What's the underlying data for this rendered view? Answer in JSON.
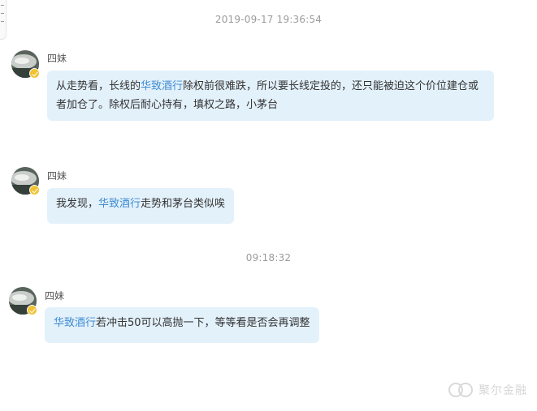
{
  "timestamps": [
    "2019-09-17 19:36:54",
    "09:18:32"
  ],
  "messages": [
    {
      "sender": "四妹",
      "segments": [
        {
          "text": "从走势看，长线的",
          "stock": false
        },
        {
          "text": "华致酒行",
          "stock": true
        },
        {
          "text": "除权前很难跌，所以要长线定投的，还只能被迫这个价位建仓或者加仓了。除权后耐心持有，填权之路，小茅台",
          "stock": false
        }
      ]
    },
    {
      "sender": "四妹",
      "segments": [
        {
          "text": "我发现，",
          "stock": false
        },
        {
          "text": "华致酒行",
          "stock": true
        },
        {
          "text": "走势和茅台类似唉",
          "stock": false
        }
      ]
    },
    {
      "sender": "四妹",
      "segments": [
        {
          "text": "华致酒行",
          "stock": true
        },
        {
          "text": "若冲击50可以高抛一下，等等看是否会再调整",
          "stock": false
        }
      ]
    }
  ],
  "watermark": "聚尔金融",
  "colors": {
    "bubble": "#e3f1fb",
    "stock_link": "#3e8bd1",
    "timestamp": "#9b9b9b",
    "badge": "#f1c232"
  }
}
